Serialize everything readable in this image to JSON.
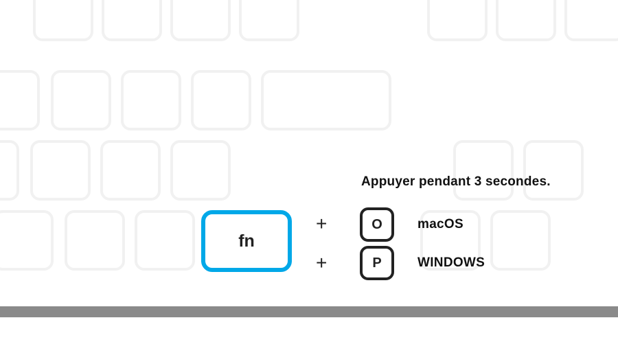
{
  "instruction": "Appuyer pendant 3 secondes.",
  "main_key": "fn",
  "combos": [
    {
      "plus": "+",
      "key": "O",
      "os": "macOS"
    },
    {
      "plus": "+",
      "key": "P",
      "os": "WINDOWS"
    }
  ],
  "colors": {
    "accent": "#00a8e8",
    "key_outline": "#222222",
    "bg_key": "#f1f1f1",
    "strip": "#8a8a8a"
  }
}
